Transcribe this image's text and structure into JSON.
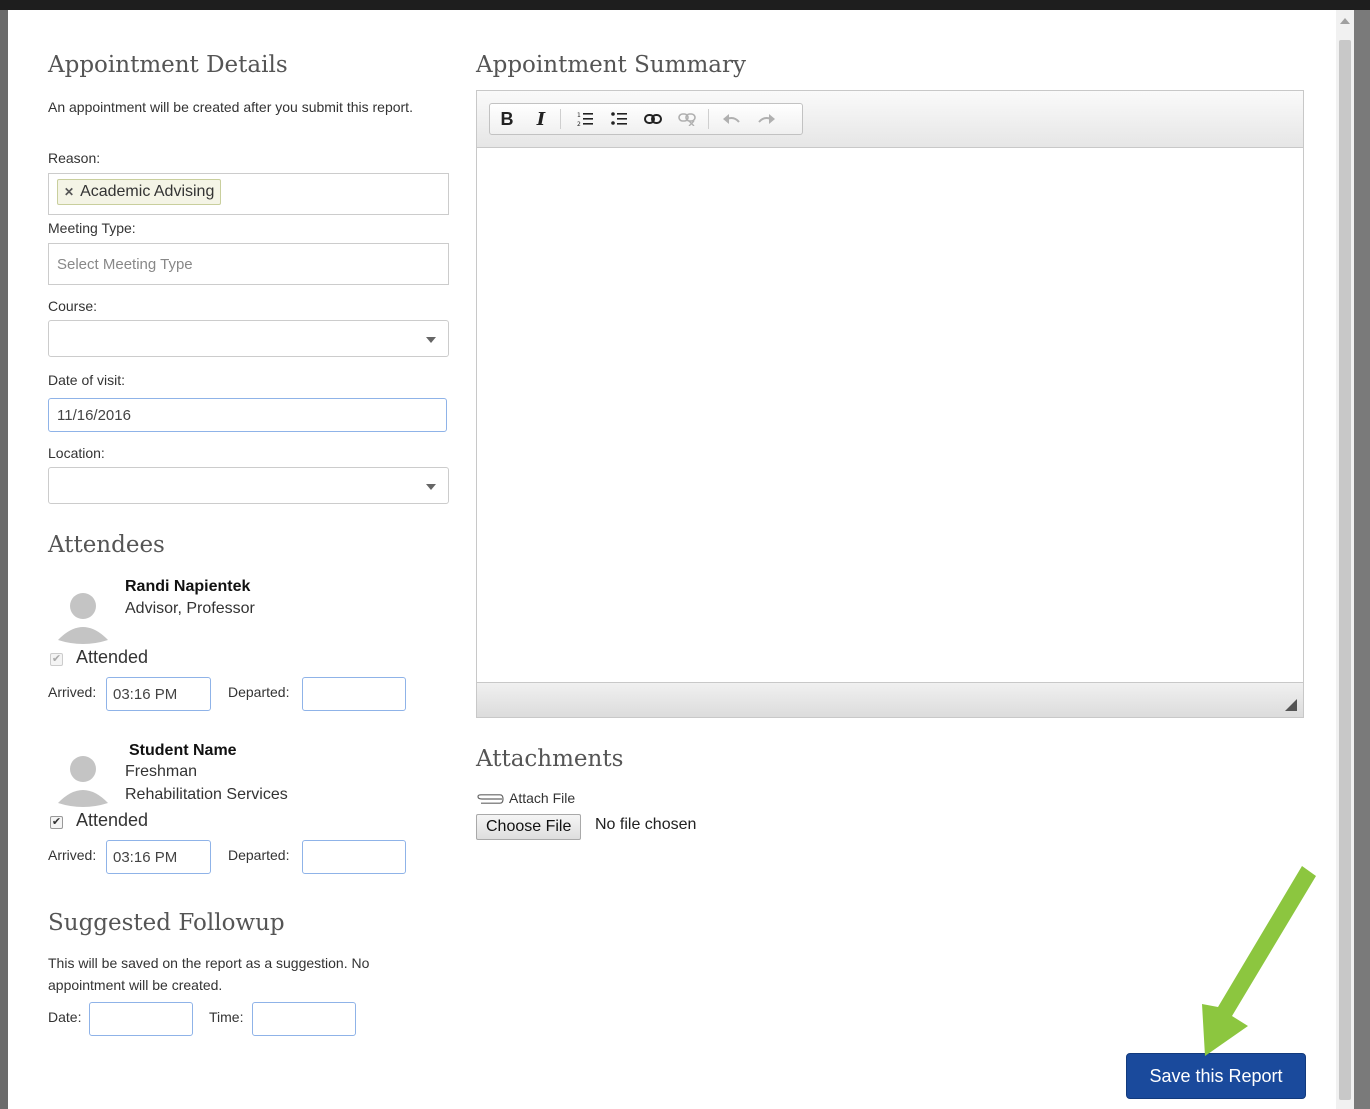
{
  "details": {
    "heading": "Appointment Details",
    "note": "An appointment will be created after you submit this report.",
    "reason_label": "Reason:",
    "reason_tag": "Academic Advising",
    "meeting_type_label": "Meeting Type:",
    "meeting_type_placeholder": "Select Meeting Type",
    "course_label": "Course:",
    "course_value": "",
    "date_label": "Date of visit:",
    "date_value": "11/16/2016",
    "location_label": "Location:",
    "location_value": ""
  },
  "attendees": {
    "heading": "Attendees",
    "items": [
      {
        "name": "Randi Napientek",
        "line1": "Advisor, Professor",
        "line2": "",
        "attended_label": "Attended",
        "attended": true,
        "checkbox_disabled": true,
        "arrived_label": "Arrived:",
        "arrived_value": "03:16 PM",
        "departed_label": "Departed:",
        "departed_value": ""
      },
      {
        "name": "Student Name",
        "line1": "Freshman",
        "line2": "Rehabilitation Services",
        "attended_label": "Attended",
        "attended": true,
        "checkbox_disabled": false,
        "arrived_label": "Arrived:",
        "arrived_value": "03:16 PM",
        "departed_label": "Departed:",
        "departed_value": ""
      }
    ]
  },
  "followup": {
    "heading": "Suggested Followup",
    "note": "This will be saved on the report as a suggestion. No appointment will be created.",
    "date_label": "Date:",
    "date_value": "",
    "time_label": "Time:",
    "time_value": ""
  },
  "summary": {
    "heading": "Appointment Summary",
    "toolbar": [
      {
        "name": "bold-icon",
        "glyph": "B"
      },
      {
        "name": "italic-icon",
        "glyph": "I"
      },
      {
        "name": "numbered-list-icon",
        "glyph": "☰"
      },
      {
        "name": "bullet-list-icon",
        "glyph": "☰"
      },
      {
        "name": "link-icon",
        "glyph": "∞"
      },
      {
        "name": "unlink-icon",
        "glyph": "∞"
      },
      {
        "name": "undo-icon",
        "glyph": "↶"
      },
      {
        "name": "redo-icon",
        "glyph": "↷"
      }
    ],
    "content": ""
  },
  "attachments": {
    "heading": "Attachments",
    "attach_label": "Attach File",
    "choose_button": "Choose File",
    "file_status": "No file chosen"
  },
  "save_button": "Save this Report",
  "colors": {
    "primary": "#1a4a9c",
    "highlight_arrow": "#8cc63f",
    "tag_bg": "#f4f4e6"
  }
}
